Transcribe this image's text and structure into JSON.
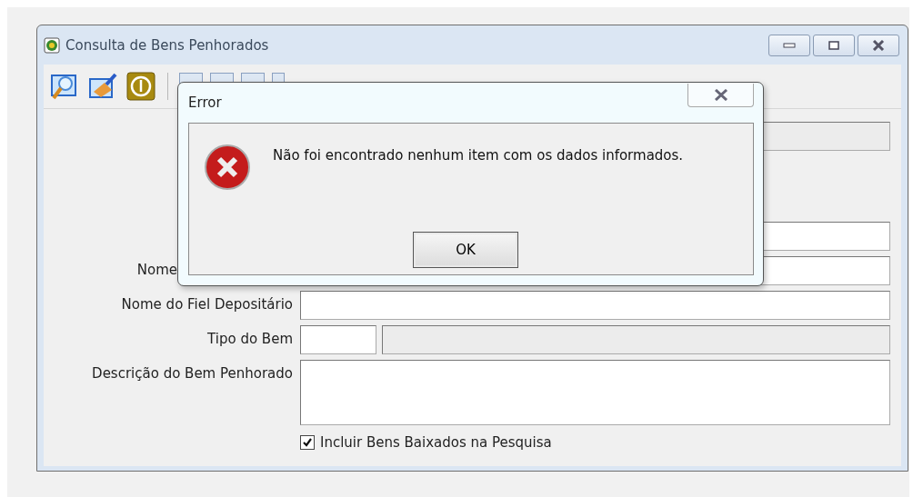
{
  "window": {
    "title": "Consulta de Bens Penhorados"
  },
  "form": {
    "rows": [
      {
        "kind": "disabled"
      },
      {
        "kind": "text"
      },
      {
        "label": "Nome",
        "kind": "partial"
      },
      {
        "label": "Nome do Fiel Depositário",
        "kind": "text"
      },
      {
        "label": "Tipo do Bem",
        "kind": "code"
      },
      {
        "label": "Descrição do Bem Penhorado",
        "kind": "area"
      }
    ],
    "checkbox": {
      "label": "Incluir Bens Baixados na Pesquisa",
      "checked": true
    }
  },
  "dialog": {
    "title": "Error",
    "message": "Não foi encontrado nenhum item com os dados informados.",
    "button": "OK"
  }
}
